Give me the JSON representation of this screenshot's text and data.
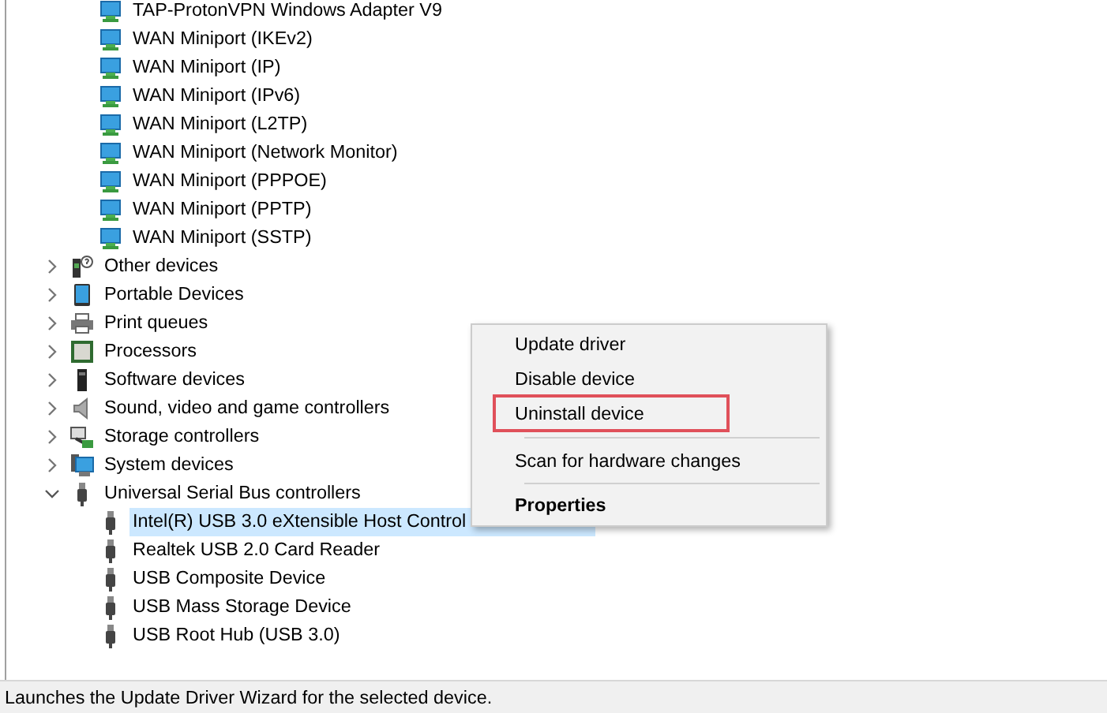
{
  "tree": {
    "partial_children": [
      {
        "label": "TAP-ProtonVPN Windows Adapter V9",
        "selected": false
      },
      {
        "label": "WAN Miniport (IKEv2)",
        "selected": false
      },
      {
        "label": "WAN Miniport (IP)",
        "selected": false
      },
      {
        "label": "WAN Miniport (IPv6)",
        "selected": false
      },
      {
        "label": "WAN Miniport (L2TP)",
        "selected": false
      },
      {
        "label": "WAN Miniport (Network Monitor)",
        "selected": false
      },
      {
        "label": "WAN Miniport (PPPOE)",
        "selected": false
      },
      {
        "label": "WAN Miniport (PPTP)",
        "selected": false
      },
      {
        "label": "WAN Miniport (SSTP)",
        "selected": false
      }
    ],
    "categories": [
      {
        "label": "Other devices",
        "kind": "unknown",
        "expanded": false
      },
      {
        "label": "Portable Devices",
        "kind": "portable",
        "expanded": false
      },
      {
        "label": "Print queues",
        "kind": "printer",
        "expanded": false
      },
      {
        "label": "Processors",
        "kind": "processor",
        "expanded": false
      },
      {
        "label": "Software devices",
        "kind": "software",
        "expanded": false
      },
      {
        "label": "Sound, video and game controllers",
        "kind": "sound",
        "expanded": false
      },
      {
        "label": "Storage controllers",
        "kind": "storage",
        "expanded": false
      },
      {
        "label": "System devices",
        "kind": "system",
        "expanded": false
      },
      {
        "label": "Universal Serial Bus controllers",
        "kind": "usb",
        "expanded": true,
        "children": [
          {
            "label": "Intel(R) USB 3.0 eXtensible Host Control",
            "selected": true
          },
          {
            "label": "Realtek USB 2.0 Card Reader",
            "selected": false
          },
          {
            "label": "USB Composite Device",
            "selected": false
          },
          {
            "label": "USB Mass Storage Device",
            "selected": false
          },
          {
            "label": "USB Root Hub (USB 3.0)",
            "selected": false
          }
        ]
      }
    ]
  },
  "context_menu": {
    "items": [
      {
        "kind": "item",
        "label": "Update driver",
        "bold": false,
        "highlighted": false
      },
      {
        "kind": "item",
        "label": "Disable device",
        "bold": false,
        "highlighted": false
      },
      {
        "kind": "item",
        "label": "Uninstall device",
        "bold": false,
        "highlighted": true
      },
      {
        "kind": "separator"
      },
      {
        "kind": "item",
        "label": "Scan for hardware changes",
        "bold": false,
        "highlighted": false
      },
      {
        "kind": "separator"
      },
      {
        "kind": "item",
        "label": "Properties",
        "bold": true,
        "highlighted": false
      }
    ]
  },
  "status_bar": {
    "text": "Launches the Update Driver Wizard for the selected device."
  }
}
